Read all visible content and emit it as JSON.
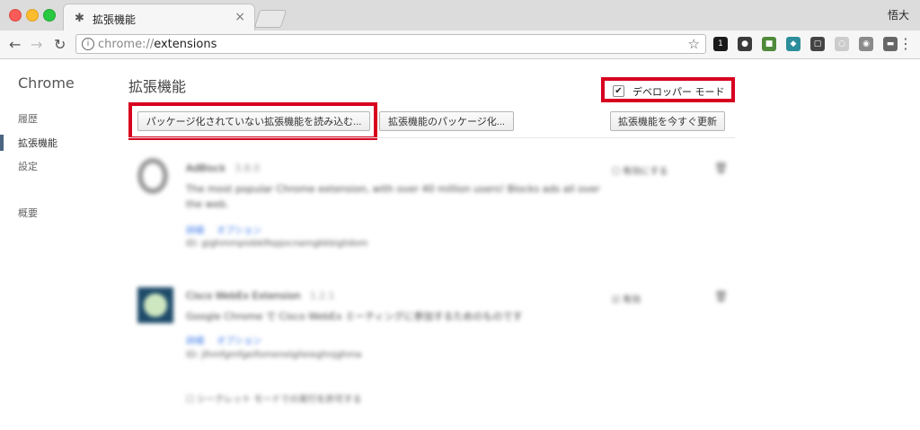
{
  "window": {
    "tab_title": "拡張機能",
    "profile_name": "悟大",
    "tab_icon": "puzzle-icon"
  },
  "toolbar": {
    "url_scheme": "chrome://",
    "url_path": "extensions",
    "extension_icons": [
      {
        "name": "onepassword-icon",
        "color": "#1a1a1a",
        "glyph": "1"
      },
      {
        "name": "evernote-icon",
        "color": "#3a3a3a",
        "glyph": "●"
      },
      {
        "name": "webclipper-icon",
        "color": "#4f8a3a",
        "glyph": "■"
      },
      {
        "name": "coupon-icon",
        "color": "#2c8e9a",
        "glyph": "◆"
      },
      {
        "name": "note-icon",
        "color": "#444444",
        "glyph": "▢"
      },
      {
        "name": "circle-ext-icon",
        "color": "#cccccc",
        "glyph": "○"
      },
      {
        "name": "camera-icon",
        "color": "#8a8a8a",
        "glyph": "◉"
      },
      {
        "name": "stripe-ext-icon",
        "color": "#666666",
        "glyph": "▬"
      }
    ]
  },
  "sidebar": {
    "title": "Chrome",
    "items": [
      {
        "label": "履歴"
      },
      {
        "label": "拡張機能"
      },
      {
        "label": "設定"
      },
      {
        "label": "概要"
      }
    ]
  },
  "main": {
    "title": "拡張機能",
    "developer_mode_label": "デベロッパー モード",
    "developer_mode_checked": "✔",
    "buttons": {
      "load_unpacked": "パッケージ化されていない拡張機能を読み込む...",
      "pack": "拡張機能のパッケージ化...",
      "update_now": "拡張機能を今すぐ更新"
    }
  },
  "extensions": [
    {
      "name": "AdBlock",
      "version": "3.8.0",
      "description": "The most popular Chrome extension, with over 40 million users! Blocks ads all over the web.",
      "links": [
        "詳細",
        "オプション"
      ],
      "id": "ID: gighmmpiobklfepjocnamgkkbiglidom",
      "status": "有効にする",
      "option": ""
    },
    {
      "name": "Cisco WebEx Extension",
      "version": "1.2.1",
      "description": "Google Chrome で Cisco WebEx ミーティングに参加するためのものです",
      "links": [
        "詳細",
        "オプション"
      ],
      "id": "ID: jlhmfgmfgeifomenelglieieghnjghma",
      "status": "有効",
      "option": "シークレット モードでの実行を許可する"
    }
  ]
}
